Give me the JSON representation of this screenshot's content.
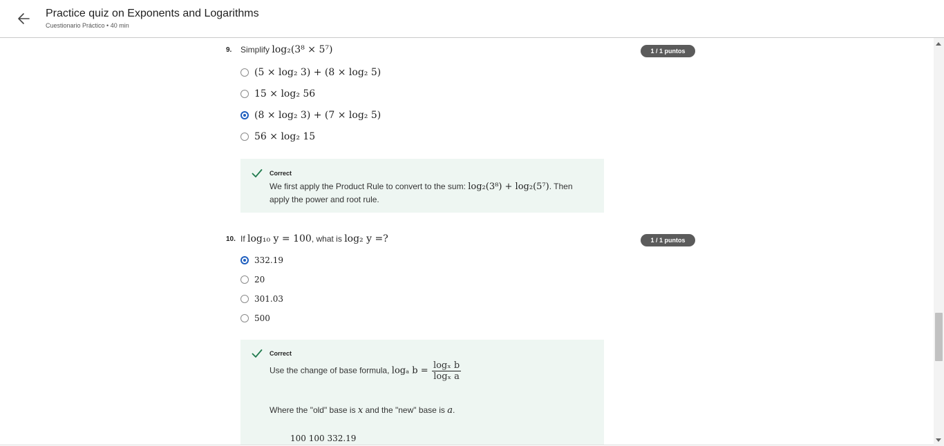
{
  "header": {
    "title": "Practice quiz on Exponents and Logarithms",
    "subtitle": "Cuestionario Práctico • 40 min"
  },
  "questions": [
    {
      "number": "9.",
      "prompt_prefix": "Simplify",
      "prompt_math": "log₂(3⁸ × 5⁷)",
      "badge": "1 / 1 puntos",
      "options": [
        {
          "label": "(5 × log₂ 3) + (8 × log₂ 5)",
          "selected": false
        },
        {
          "label": "15 × log₂ 56",
          "selected": false
        },
        {
          "label": "(8 × log₂ 3) + (7 × log₂ 5)",
          "selected": true
        },
        {
          "label": "56 × log₂ 15",
          "selected": false
        }
      ],
      "feedback": {
        "status": "Correct",
        "text_before": "We first apply the Product Rule to convert to the sum: ",
        "math": "log₂(3⁸) + log₂(5⁷)",
        "text_after": ". Then",
        "text_line2": "apply the power and root rule."
      }
    },
    {
      "number": "10.",
      "prompt_prefix": "If",
      "prompt_math1": "log₁₀ y = 100",
      "prompt_mid": ", what is",
      "prompt_math2": "log₂ y =?",
      "badge": "1 / 1 puntos",
      "options": [
        {
          "label": "332.19",
          "selected": true
        },
        {
          "label": "20",
          "selected": false
        },
        {
          "label": "301.03",
          "selected": false
        },
        {
          "label": "500",
          "selected": false
        }
      ],
      "feedback": {
        "status": "Correct",
        "formula_intro": "Use the change of base formula,",
        "formula_lhs": "logₐ b =",
        "formula_num": "logₓ b",
        "formula_den": "logₓ a",
        "where_text_1": "Where the \"old\" base is ",
        "where_math_1": "x",
        "where_text_2": " and the \"new\" base is ",
        "where_math_2": "a",
        "where_text_3": ".",
        "partial_line": "100            100          332.19"
      }
    }
  ],
  "colors": {
    "accent": "#1f5fbf",
    "badge": "#5b5b5b",
    "feedback_bg": "#eef6f2",
    "check": "#1f7a4d"
  }
}
